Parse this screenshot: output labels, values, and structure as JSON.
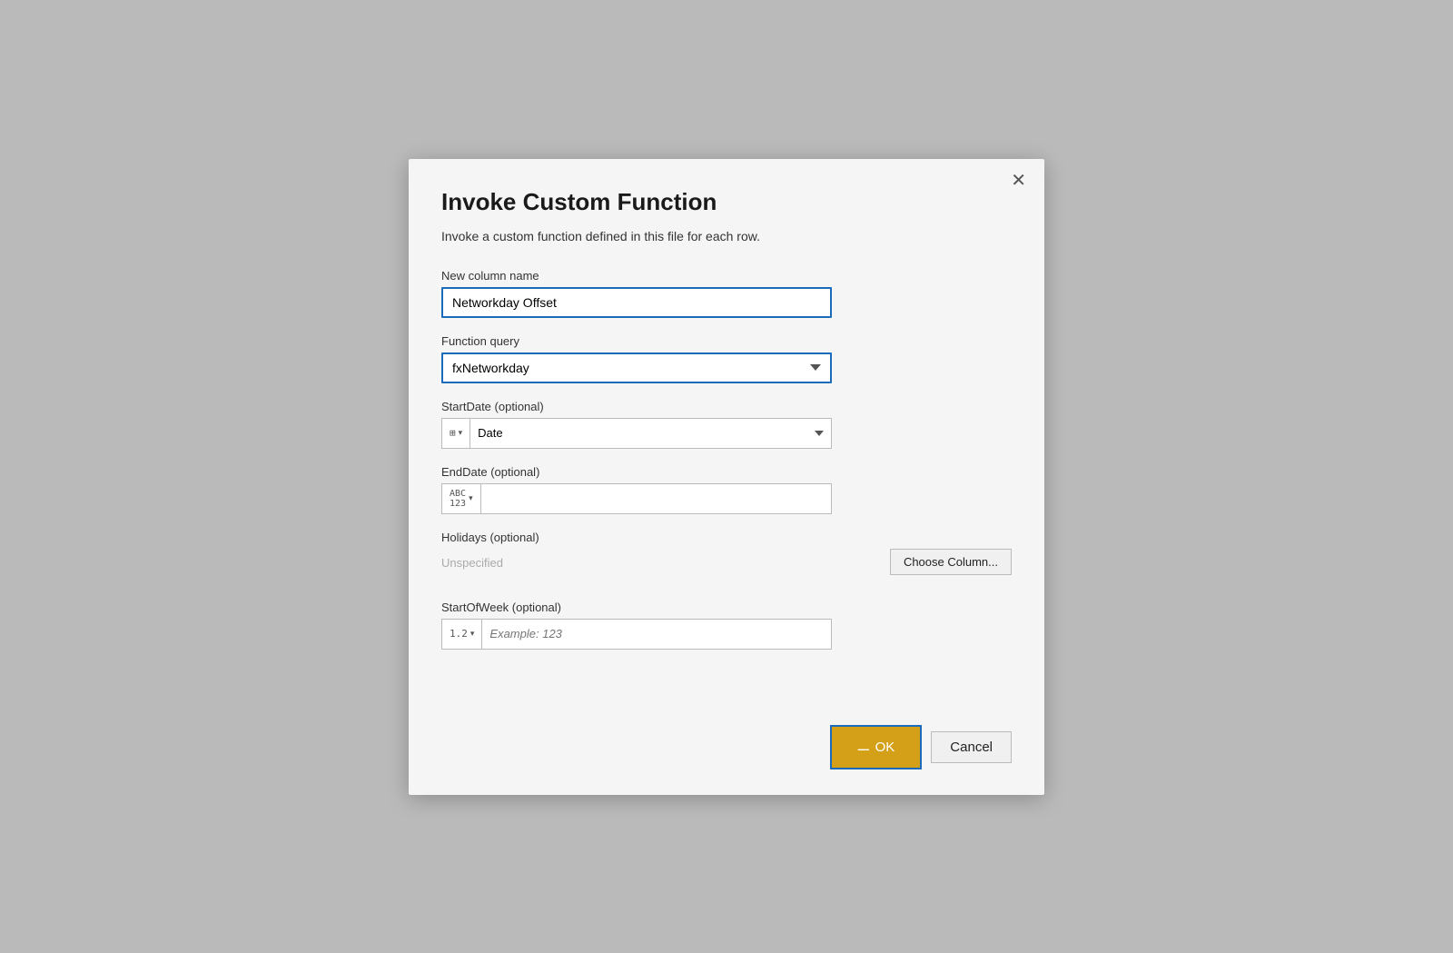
{
  "dialog": {
    "title": "Invoke Custom Function",
    "subtitle": "Invoke a custom function defined in this file for each row.",
    "close_label": "✕",
    "new_column_label": "New column name",
    "new_column_value": "Networkday Offset",
    "function_query_label": "Function query",
    "function_query_value": "fxNetworkday",
    "start_date_label": "StartDate (optional)",
    "start_date_type": "table",
    "start_date_type_icon": "⊞",
    "start_date_value": "Date",
    "end_date_label": "EndDate (optional)",
    "end_date_type": "abc",
    "end_date_type_icon": "ABC\n123",
    "end_date_value": "",
    "holidays_label": "Holidays (optional)",
    "holidays_unspecified": "Unspecified",
    "choose_column_label": "Choose Column...",
    "start_of_week_label": "StartOfWeek (optional)",
    "start_of_week_type": "1.2",
    "start_of_week_placeholder": "Example: 123",
    "ok_label": "OK",
    "cancel_label": "Cancel"
  }
}
